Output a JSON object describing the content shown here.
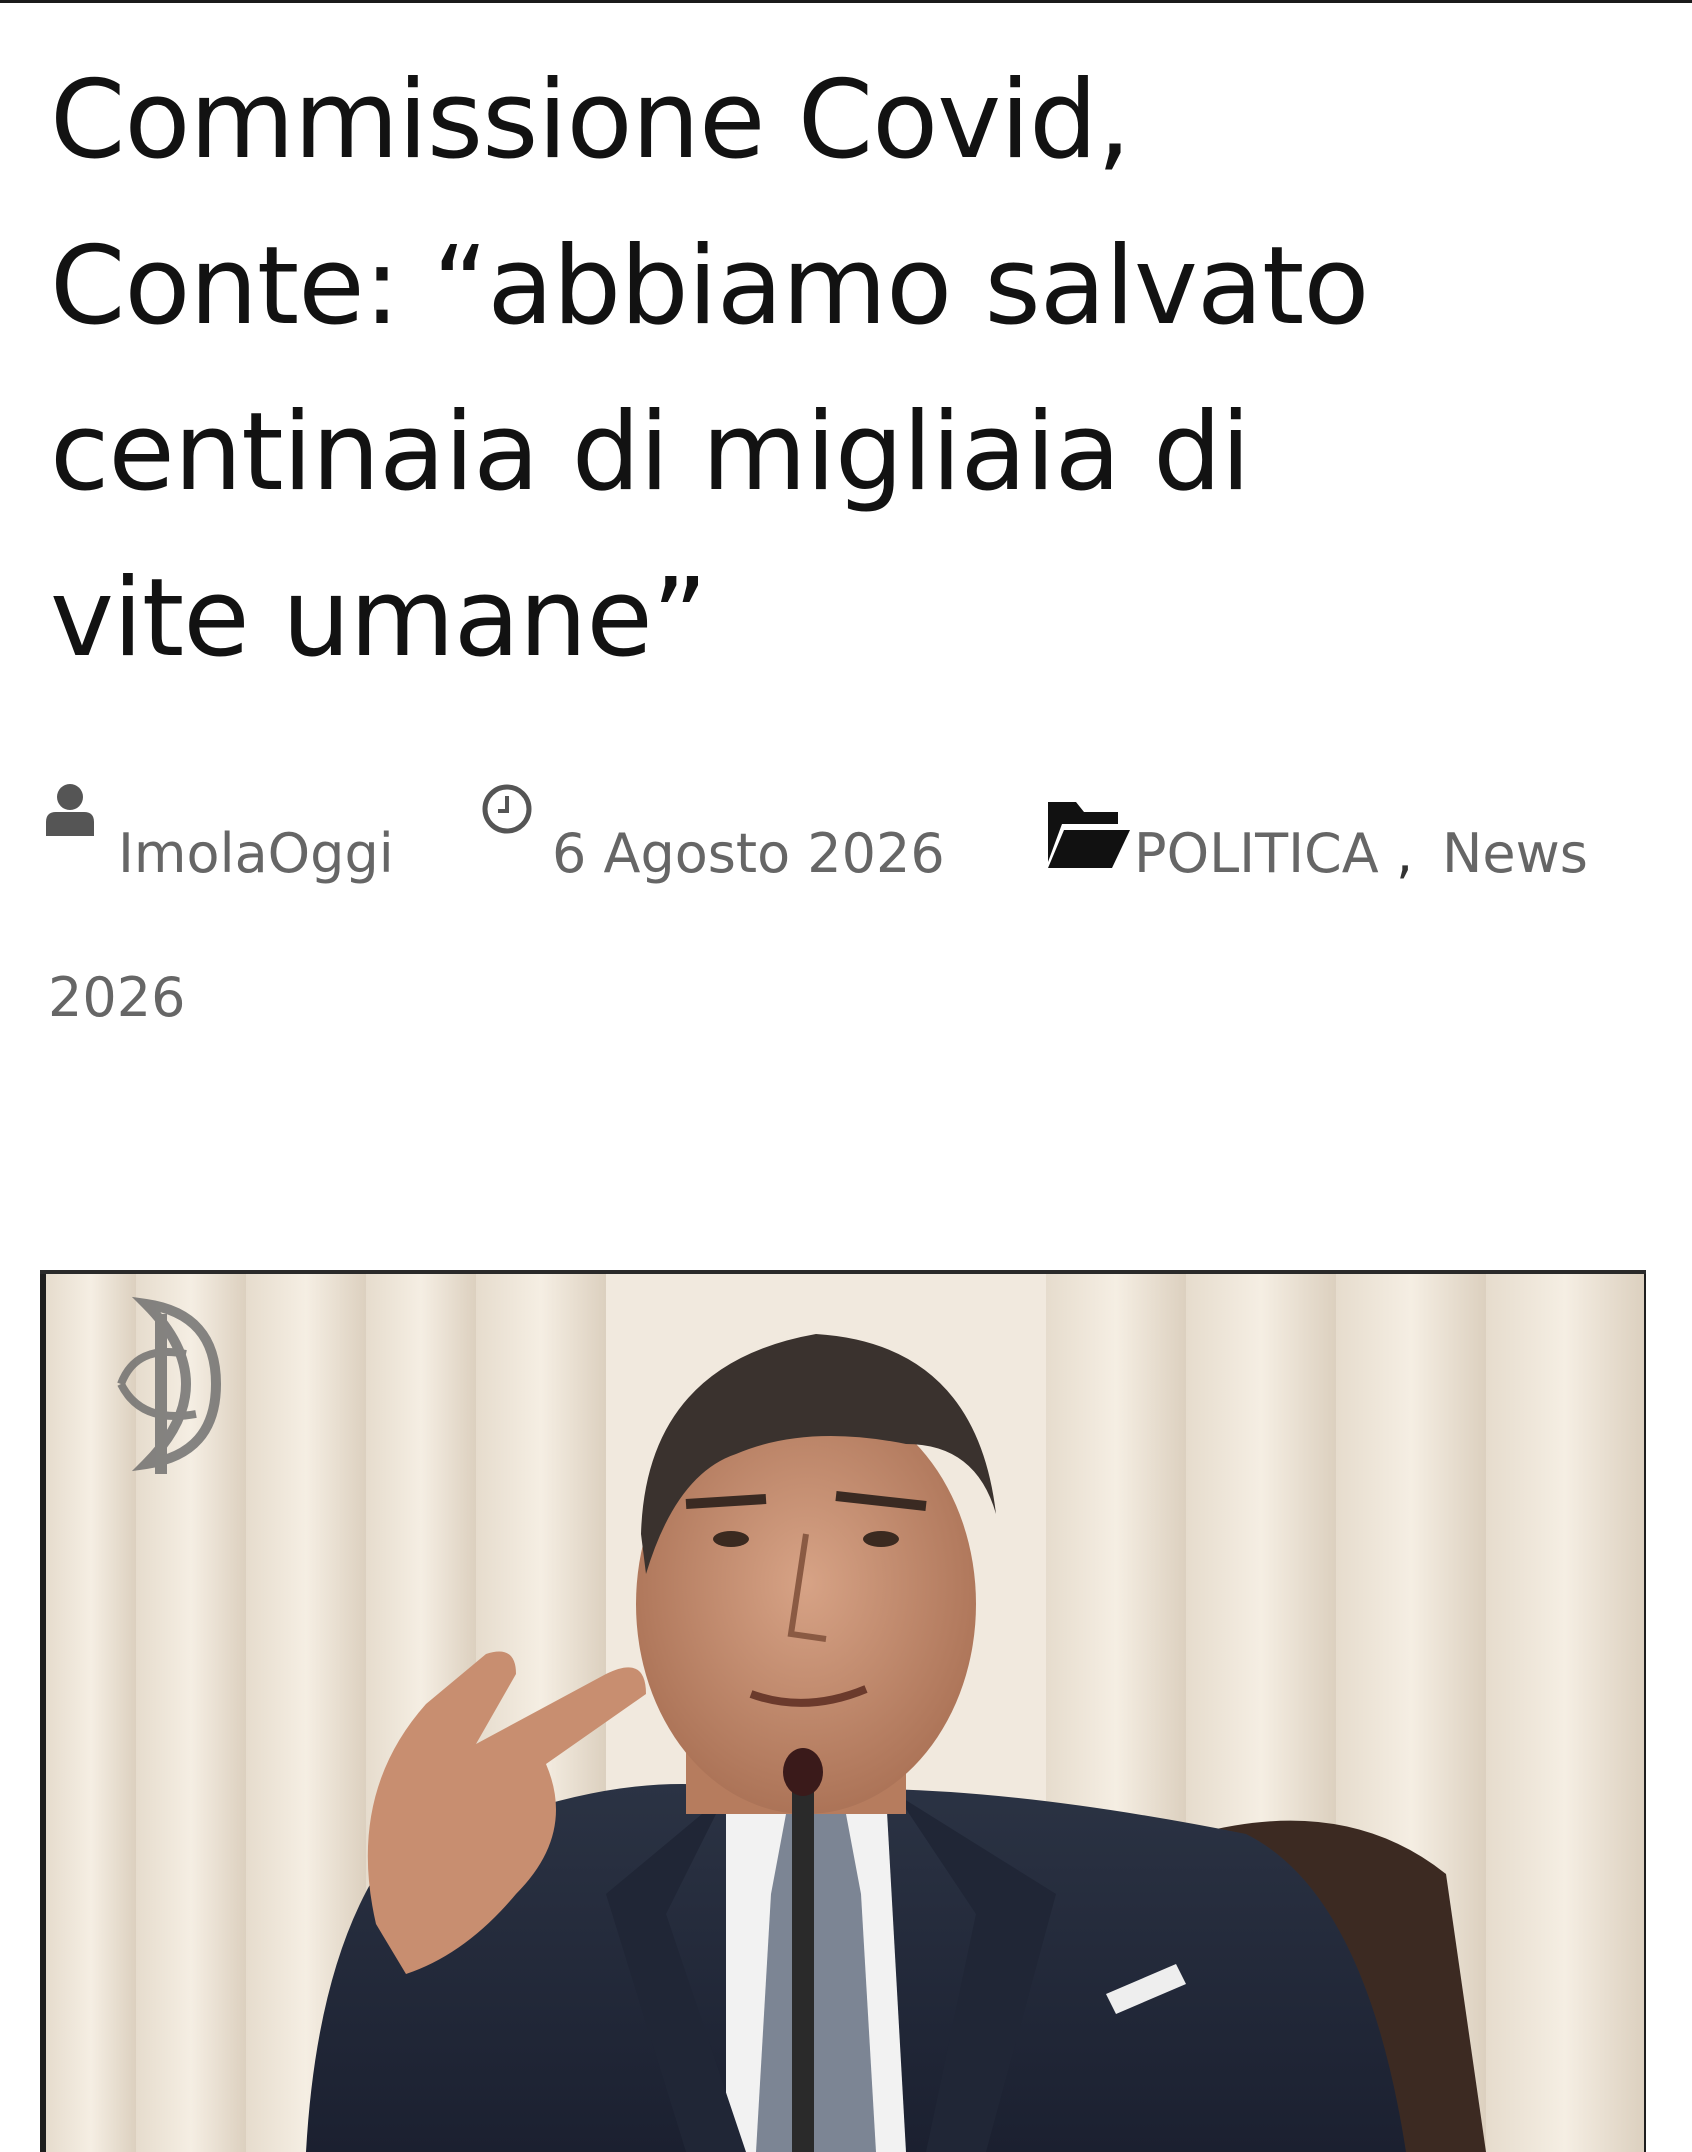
{
  "article": {
    "headline_lines": [
      "Commissione Covid,",
      "Conte: “abbiamo salvato",
      "centinaia di migliaia di",
      "vite umane”"
    ],
    "author": "ImolaOggi",
    "date": "6 Agosto 2026",
    "category_1": "POLITICA",
    "separator": ",",
    "category_2_part1": "News",
    "category_2_part2": "2026"
  },
  "icons": {
    "author": "user-icon",
    "date": "clock-icon",
    "category": "folder-open-icon"
  },
  "colors": {
    "headline": "#121212",
    "meta_text": "#666666",
    "icons": "#555555",
    "background": "#ffffff"
  },
  "photo": {
    "emblem_text": "RI"
  }
}
